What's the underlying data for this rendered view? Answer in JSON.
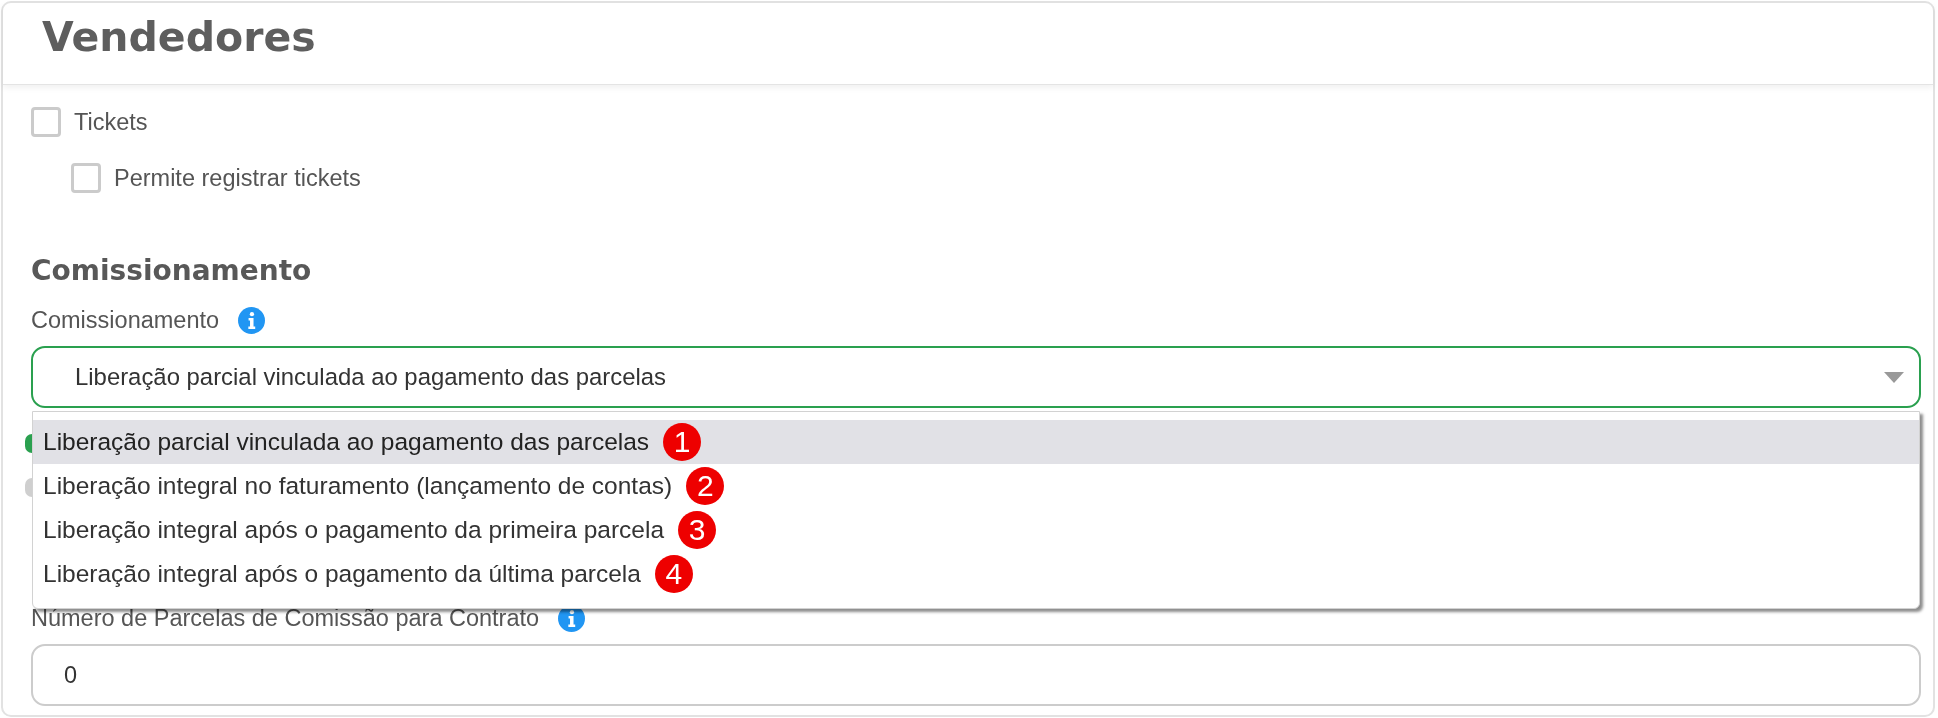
{
  "header": {
    "title": "Vendedores"
  },
  "permissions": [
    {
      "label": "Tickets",
      "checked": false,
      "children": [
        {
          "label": "Permite registrar tickets",
          "checked": false
        }
      ]
    }
  ],
  "section": {
    "title": "Comissionamento"
  },
  "commission_field": {
    "label": "Comissionamento",
    "value": "Liberação parcial vinculada ao pagamento das parcelas",
    "focused": true,
    "expanded": true,
    "options": [
      {
        "label": "Liberação parcial vinculada ao pagamento das parcelas",
        "selected": true,
        "annotation": "1"
      },
      {
        "label": "Liberação integral no faturamento (lançamento de contas)",
        "selected": false,
        "annotation": "2"
      },
      {
        "label": "Liberação integral após o pagamento da primeira parcela",
        "selected": false,
        "annotation": "3"
      },
      {
        "label": "Liberação integral após o pagamento da última parcela",
        "selected": false,
        "annotation": "4"
      }
    ]
  },
  "switches": [
    {
      "on": true
    },
    {
      "on": false
    }
  ],
  "installments_field": {
    "label": "Número de Parcelas de Comissão para Contrato",
    "value": "0"
  }
}
